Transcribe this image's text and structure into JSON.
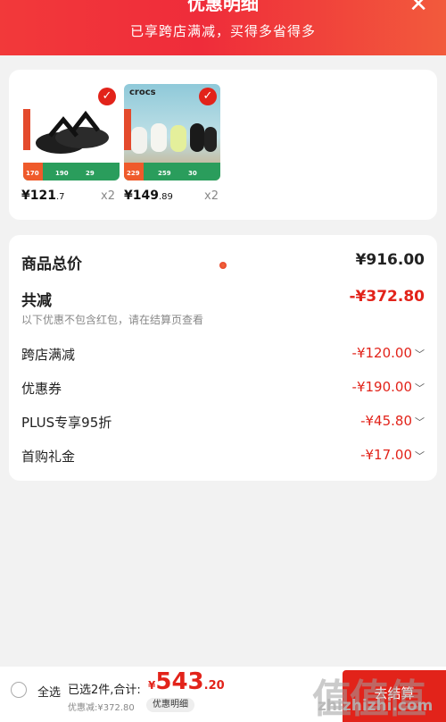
{
  "header": {
    "title": "优惠明细",
    "subtitle": "已享跨店满减，买得多省得多",
    "close_icon": "close-icon"
  },
  "products": [
    {
      "price_int": "¥121",
      "price_dec": ".7",
      "qty": "x2",
      "tag_numbers": [
        "170",
        "190",
        "29"
      ]
    },
    {
      "brand": "crocs",
      "price_int": "¥149",
      "price_dec": ".89",
      "qty": "x2",
      "tag_numbers": [
        "229",
        "259",
        "30"
      ]
    }
  ],
  "summary": {
    "total_label": "商品总价",
    "total_value": "¥916.00",
    "reduce_label": "共减",
    "reduce_value": "-¥372.80",
    "note": "以下优惠不包含红包，请在结算页查看",
    "items": [
      {
        "label": "跨店满减",
        "value": "-¥120.00"
      },
      {
        "label": "优惠券",
        "value": "-¥190.00"
      },
      {
        "label": "PLUS专享95折",
        "value": "-¥45.80"
      },
      {
        "label": "首购礼金",
        "value": "-¥17.00"
      }
    ]
  },
  "footer": {
    "select_all": "全选",
    "selected_count": "已选2件,合计:",
    "total_currency": "¥",
    "total_int": "543",
    "total_dec": ".20",
    "saved": "优惠减:¥372.80",
    "detail_button": "优惠明细",
    "checkout": "去结算"
  },
  "watermark": {
    "logo": "值值值",
    "url": "zhizhizhi.com"
  },
  "colors": {
    "accent": "#e2231a",
    "header": "#f2393a"
  }
}
